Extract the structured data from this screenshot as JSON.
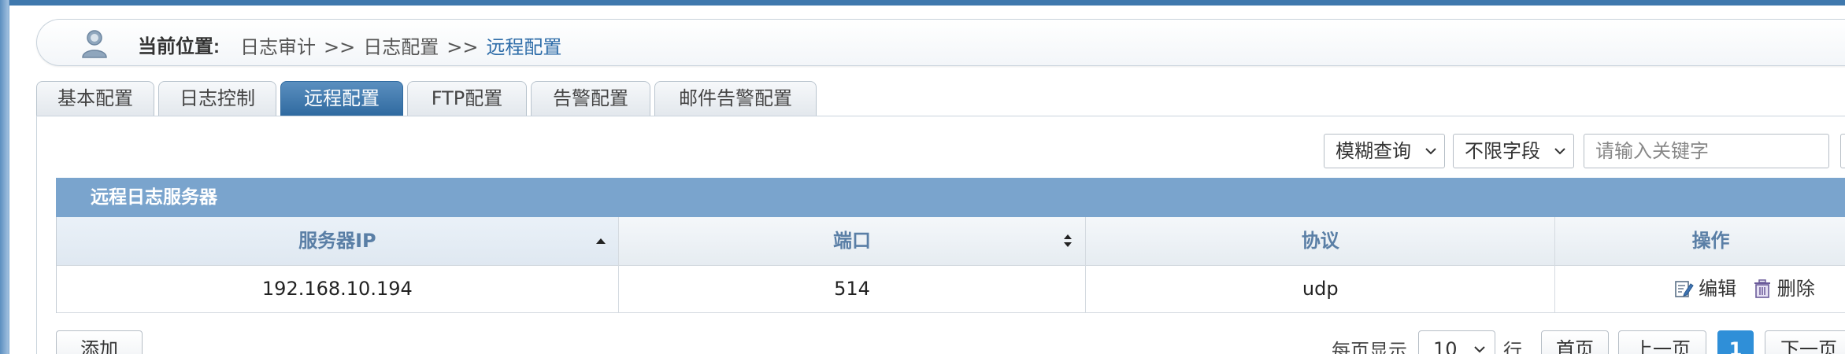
{
  "breadcrumb": {
    "label": "当前位置:",
    "path": [
      "日志审计",
      ">>",
      "日志配置",
      ">>"
    ],
    "current": "远程配置"
  },
  "tabs": [
    {
      "label": "基本配置",
      "active": false
    },
    {
      "label": "日志控制",
      "active": false
    },
    {
      "label": "远程配置",
      "active": true
    },
    {
      "label": "FTP配置",
      "active": false
    },
    {
      "label": "告警配置",
      "active": false
    },
    {
      "label": "邮件告警配置",
      "active": false
    }
  ],
  "search": {
    "mode": "模糊查询",
    "field": "不限字段",
    "placeholder": "请输入关键字"
  },
  "grid": {
    "title": "远程日志服务器",
    "columns": [
      "服务器IP",
      "端口",
      "协议",
      "操作"
    ],
    "rows": [
      {
        "ip": "192.168.10.194",
        "port": "514",
        "protocol": "udp"
      }
    ],
    "actions": {
      "edit": "编辑",
      "delete": "删除"
    }
  },
  "toolbar": {
    "add_label": "添加"
  },
  "pager": {
    "per_page_label": "每页显示",
    "per_page_value": "10",
    "unit_label": "行",
    "first": "首页",
    "prev": "上一页",
    "current_page": "1",
    "next": "下一页"
  },
  "colors": {
    "accent": "#2f6aa0",
    "header_bar": "#7aa4cd",
    "page_current": "#2f8fd8"
  }
}
